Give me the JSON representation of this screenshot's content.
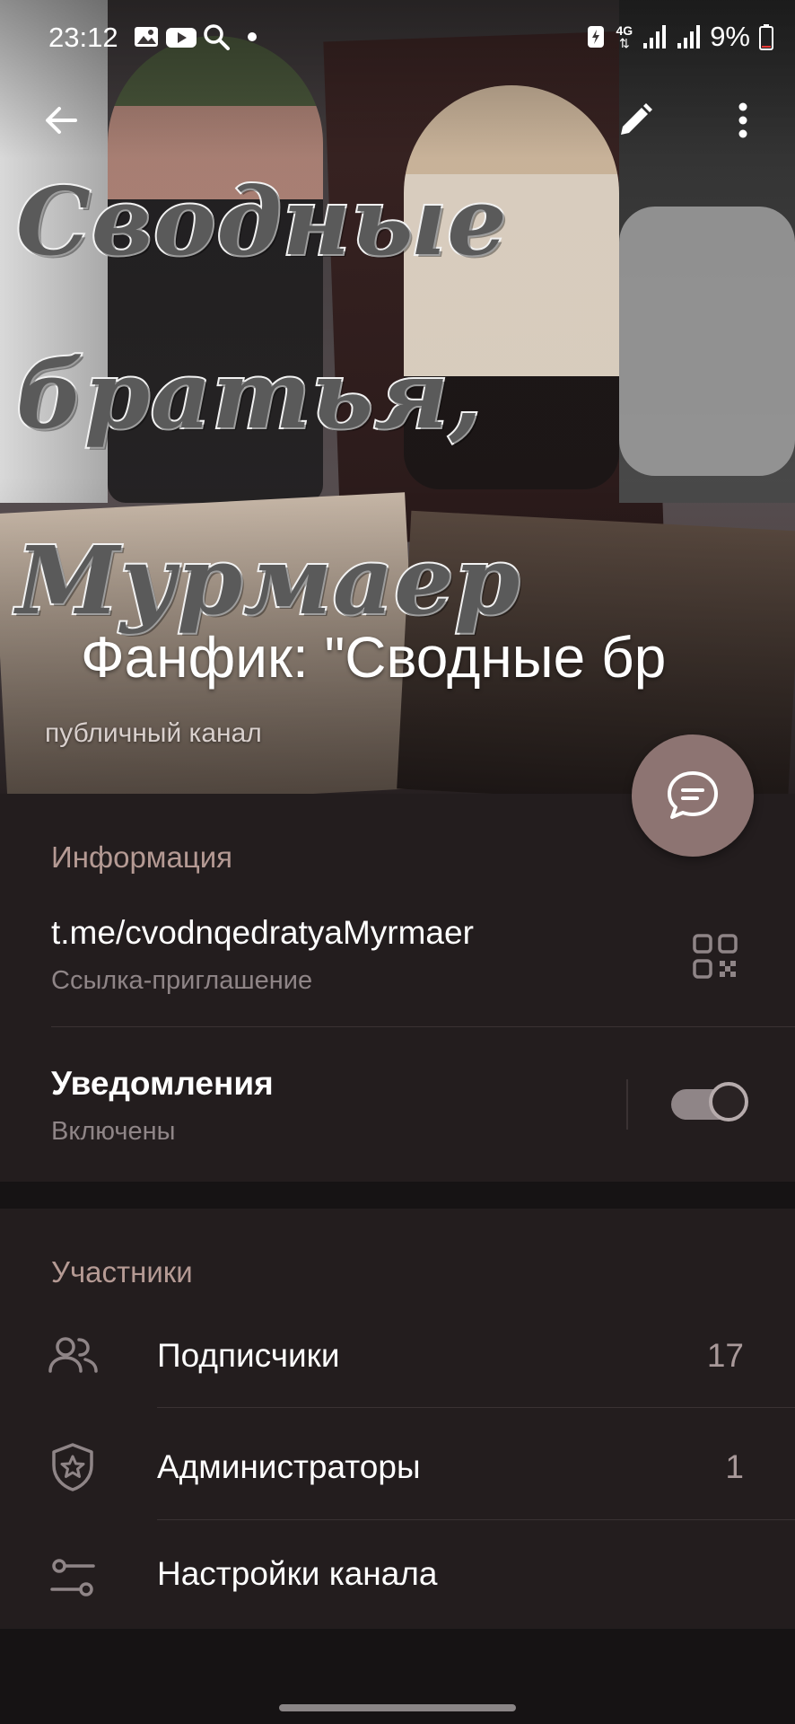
{
  "status_bar": {
    "time": "23:12",
    "left_icons": [
      "gallery-icon",
      "youtube-icon",
      "search-icon",
      "dot-icon"
    ],
    "network": "4G",
    "battery": "9%"
  },
  "cover": {
    "title_lines": [
      "Сводные",
      "братья,",
      "Мурмаер"
    ]
  },
  "channel": {
    "title": "Фанфик: \"Сводные бр",
    "subtitle": "публичный канал"
  },
  "info": {
    "section_title": "Информация",
    "link": "t.me/cvodnqedratyaMyrmaer",
    "link_caption": "Ссылка-приглашение",
    "notifications_label": "Уведомления",
    "notifications_state": "Включены",
    "notifications_enabled": true
  },
  "members": {
    "section_title": "Участники",
    "rows": [
      {
        "label": "Подписчики",
        "count": "17",
        "icon": "users-icon"
      },
      {
        "label": "Администраторы",
        "count": "1",
        "icon": "shield-star-icon"
      },
      {
        "label": "Настройки канала",
        "count": "",
        "icon": "sliders-icon"
      }
    ]
  },
  "colors": {
    "background": "#161314",
    "card": "#231d1e",
    "accent": "#b59a94",
    "fab": "#8d7472"
  }
}
